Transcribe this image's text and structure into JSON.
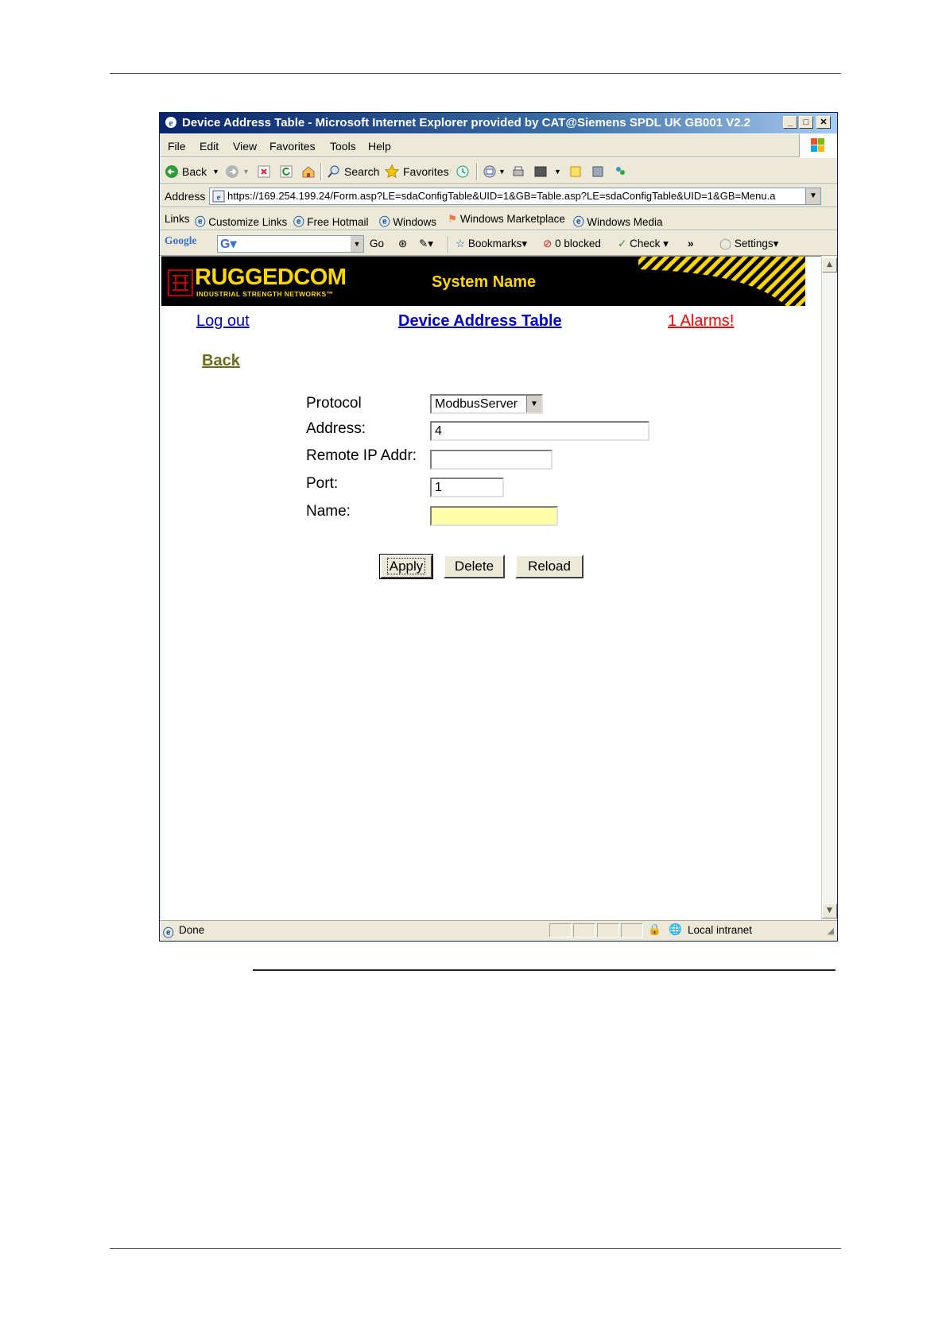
{
  "window": {
    "title": "Device Address Table - Microsoft Internet Explorer provided by CAT@Siemens SPDL UK GB001 V2.2"
  },
  "menu": [
    "File",
    "Edit",
    "View",
    "Favorites",
    "Tools",
    "Help"
  ],
  "toolbar": {
    "back_label": "Back",
    "search_label": "Search",
    "favorites_label": "Favorites"
  },
  "address_bar": {
    "label": "Address",
    "url": "https://169.254.199.24/Form.asp?LE=sdaConfigTable&UID=1&GB=Table.asp?LE=sdaConfigTable&UID=1&GB=Menu.a"
  },
  "links_bar": {
    "label": "Links",
    "items": [
      "Customize Links",
      "Free Hotmail",
      "Windows",
      "Windows Marketplace",
      "Windows Media"
    ]
  },
  "google_bar": {
    "logo": "Google",
    "go_label": "Go",
    "bookmarks_label": "Bookmarks",
    "blocked_label": "0 blocked",
    "check_label": "Check",
    "more_label": "»",
    "settings_label": "Settings"
  },
  "banner": {
    "logo_text": "RUGGEDCOM",
    "tagline": "INDUSTRIAL STRENGTH NETWORKS™",
    "system_name": "System Name"
  },
  "nav": {
    "logout": "Log out",
    "page_title": "Device Address Table",
    "alarms": "1 Alarms!",
    "back": "Back"
  },
  "form": {
    "protocol_label": "Protocol",
    "protocol_value": "ModbusServer",
    "address_label": "Address:",
    "address_value": "4",
    "remote_ip_label": "Remote IP Addr:",
    "remote_ip_value": "",
    "port_label": "Port:",
    "port_value": "1",
    "name_label": "Name:",
    "name_value": ""
  },
  "buttons": {
    "apply": "Apply",
    "delete": "Delete",
    "reload": "Reload"
  },
  "status_bar": {
    "status": "Done",
    "zone": "Local intranet"
  },
  "colors": {
    "banner_bg": "#000000",
    "banner_text": "#ffd700",
    "link_blue": "#0000cc",
    "alarm_red": "#ff0000",
    "back_link": "#6b6b1f",
    "name_field_bg": "#ffffa8"
  }
}
